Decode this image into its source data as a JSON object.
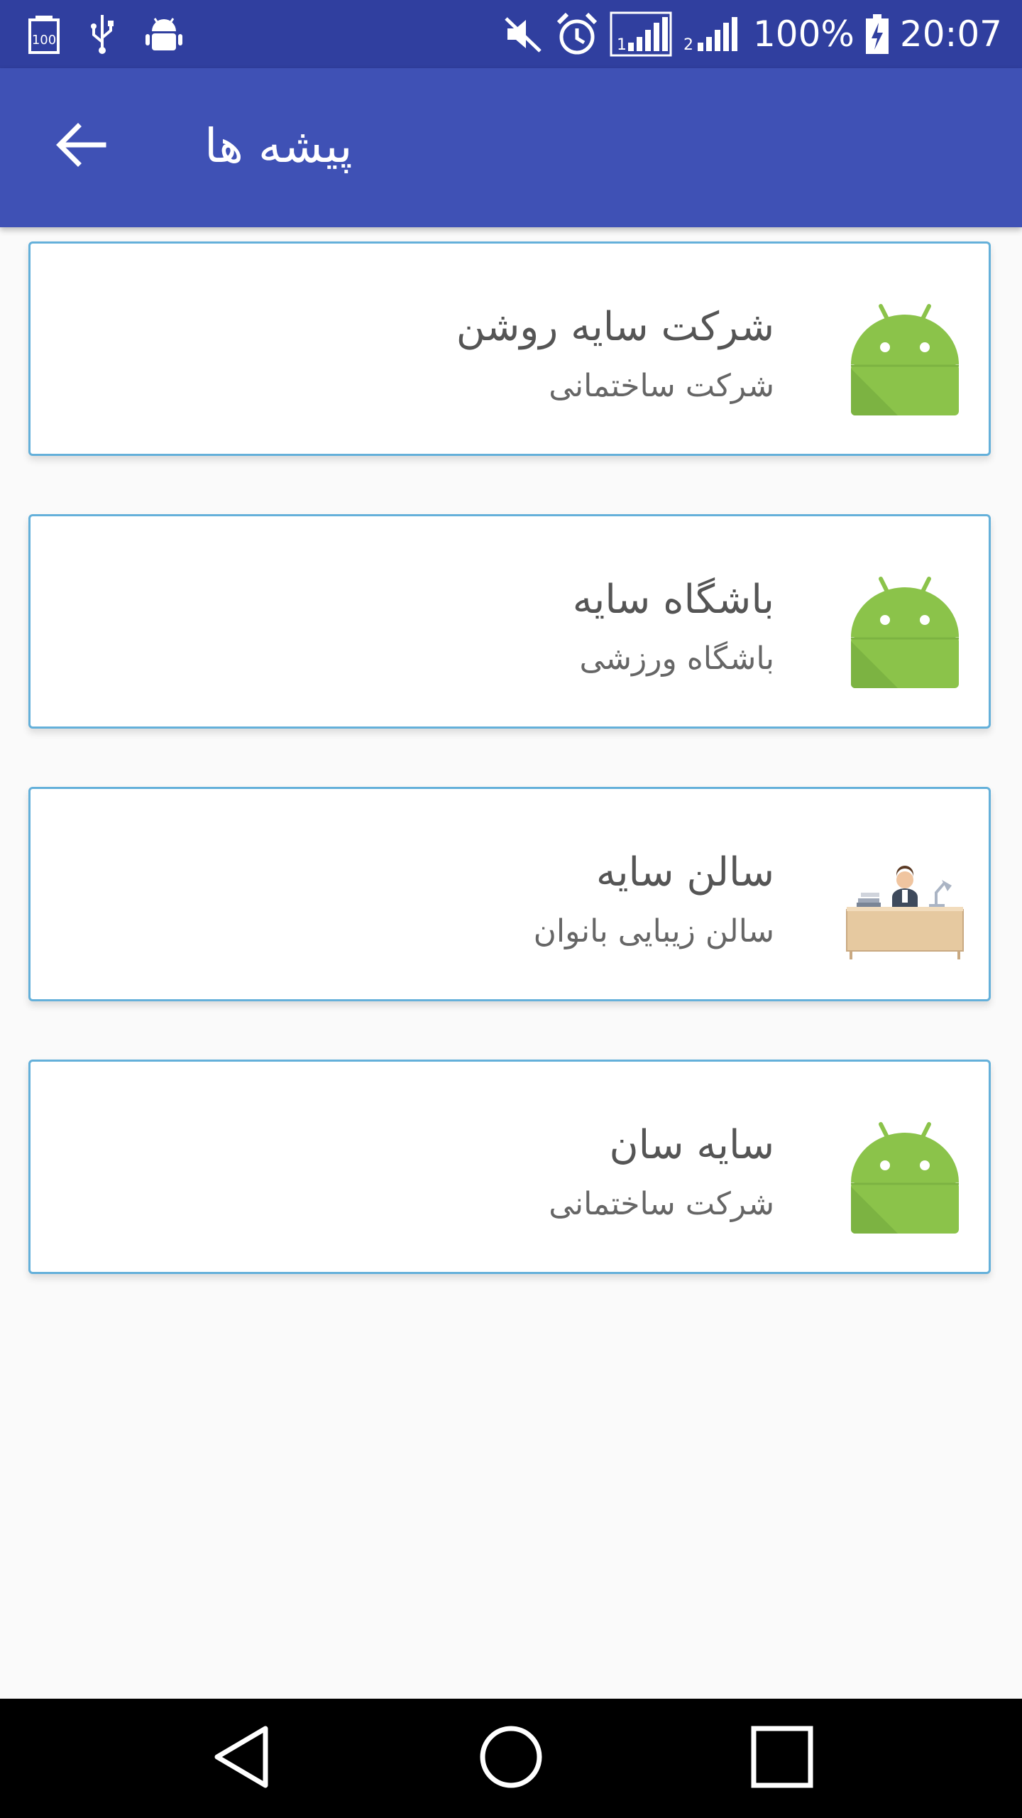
{
  "status_bar": {
    "battery_percent": "100%",
    "time": "20:07",
    "icons": [
      "battery-100-icon",
      "usb-icon",
      "android-debug-icon",
      "muted-icon",
      "alarm-icon",
      "signal-sim1-icon",
      "signal-sim2-icon",
      "battery-charging-icon"
    ]
  },
  "app_bar": {
    "title": "پیشه ها",
    "back_icon": "arrow-left-icon"
  },
  "list": {
    "items": [
      {
        "title": "شرکت سایه روشن",
        "subtitle": "شرکت ساختمانی",
        "icon": "android-icon"
      },
      {
        "title": "باشگاه سایه",
        "subtitle": "باشگاه ورزشی",
        "icon": "android-icon"
      },
      {
        "title": "سالن سایه",
        "subtitle": "سالن زیبایی بانوان",
        "icon": "desk-worker-icon"
      },
      {
        "title": "سایه سان",
        "subtitle": "شرکت ساختمانی",
        "icon": "android-icon"
      }
    ]
  },
  "nav_bar": {
    "buttons": [
      "back-triangle-icon",
      "home-circle-icon",
      "recents-square-icon"
    ]
  },
  "colors": {
    "status_bar": "#303f9f",
    "app_bar": "#3f51b5",
    "card_border": "#64b0da",
    "android_green": "#8bc34a"
  }
}
